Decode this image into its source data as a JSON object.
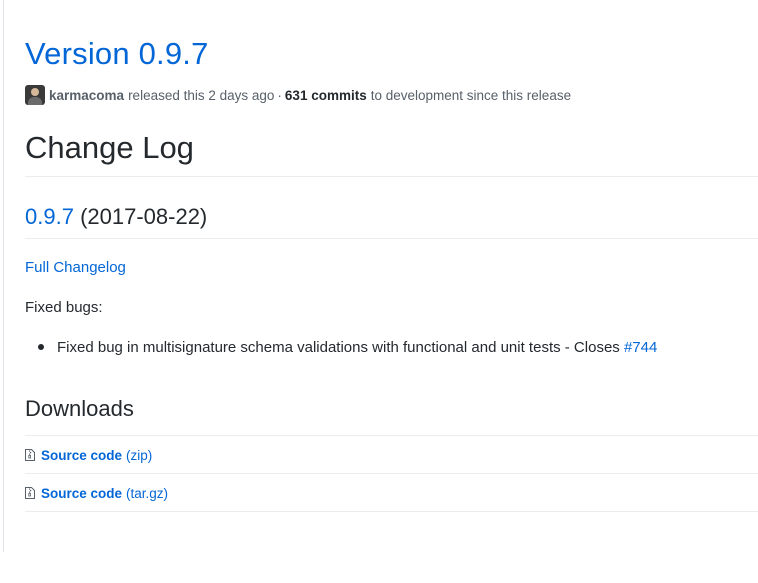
{
  "release": {
    "title": "Version 0.9.7",
    "author": "karmacoma",
    "released_text": "released this 2 days ago",
    "separator": "·",
    "commits": "631 commits",
    "commits_suffix": "to development since this release"
  },
  "changelog": {
    "heading": "Change Log",
    "version_link": "0.9.7",
    "version_date": "(2017-08-22)",
    "full_changelog_label": "Full Changelog",
    "fixed_bugs_label": "Fixed bugs:",
    "bugs": [
      {
        "text": "Fixed bug in multisignature schema validations with functional and unit tests - Closes",
        "issue": "#744"
      }
    ]
  },
  "downloads": {
    "heading": "Downloads",
    "items": [
      {
        "label": "Source code",
        "format": "(zip)",
        "icon": "file-zip-icon"
      },
      {
        "label": "Source code",
        "format": "(tar.gz)",
        "icon": "file-zip-icon"
      }
    ]
  },
  "colors": {
    "link": "#0366d6",
    "text": "#24292e",
    "muted": "#586069",
    "divider": "#eaecef"
  }
}
